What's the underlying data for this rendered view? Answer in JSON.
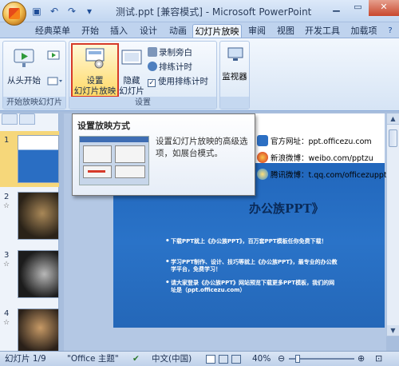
{
  "window": {
    "title": "测试.ppt [兼容模式] - Microsoft PowerPoint"
  },
  "qat": {
    "icons": [
      "save-icon",
      "undo-icon",
      "redo-icon",
      "customize-qat-icon"
    ]
  },
  "tabs": [
    {
      "label": "经典菜单"
    },
    {
      "label": "开始"
    },
    {
      "label": "插入"
    },
    {
      "label": "设计"
    },
    {
      "label": "动画"
    },
    {
      "label": "幻灯片放映",
      "active": true
    },
    {
      "label": "审阅"
    },
    {
      "label": "视图"
    },
    {
      "label": "开发工具"
    },
    {
      "label": "加载项"
    }
  ],
  "ribbon": {
    "group1": {
      "label": "开始放映幻灯片",
      "from_start": "从头开始"
    },
    "group2": {
      "label": "设置",
      "setup_show_line1": "设置",
      "setup_show_line2": "幻灯片放映",
      "hide_line1": "隐藏",
      "hide_line2": "幻灯片",
      "record_narration": "录制旁白",
      "rehearse_timings": "排练计时",
      "use_timings": "使用排练计时",
      "use_timings_checked": true
    },
    "group3": {
      "monitors": "监视器"
    }
  },
  "tooltip": {
    "title": "设置放映方式",
    "body": "设置幻灯片放映的高级选项，如展台模式。"
  },
  "slides_panel": {
    "numbers": [
      "1",
      "2",
      "3",
      "4"
    ],
    "star": "☆"
  },
  "slide": {
    "website": "官方网址：ppt.officezu.com",
    "weibo_sina": "新浪微博：weibo.com/pptzu",
    "weibo_qq": "腾讯微博：t.qq.com/officezuppt",
    "title_fragment": "办公族PPT》",
    "bullets": [
      "下载PPT就上《办公族PPT》，百万套PPT模板任你免费下载！",
      "学习PPT制作、设计、技巧等就上《办公族PPT》，最专业的办公教学平台，免费学习！",
      "请大家登录《办公族PPT》网站预览下载更多PPT模板，我们的网址是（ppt.officezu.com）"
    ]
  },
  "status_bar": {
    "slide_count": "幻灯片 1/9",
    "theme": "\"Office 主题\"",
    "language": "中文(中国)",
    "zoom": "40%"
  },
  "colors": {
    "accent_highlight": "#d63a2a",
    "slide_blue": "#1c5fb4",
    "ribbon_bg": "#dae7f6"
  }
}
